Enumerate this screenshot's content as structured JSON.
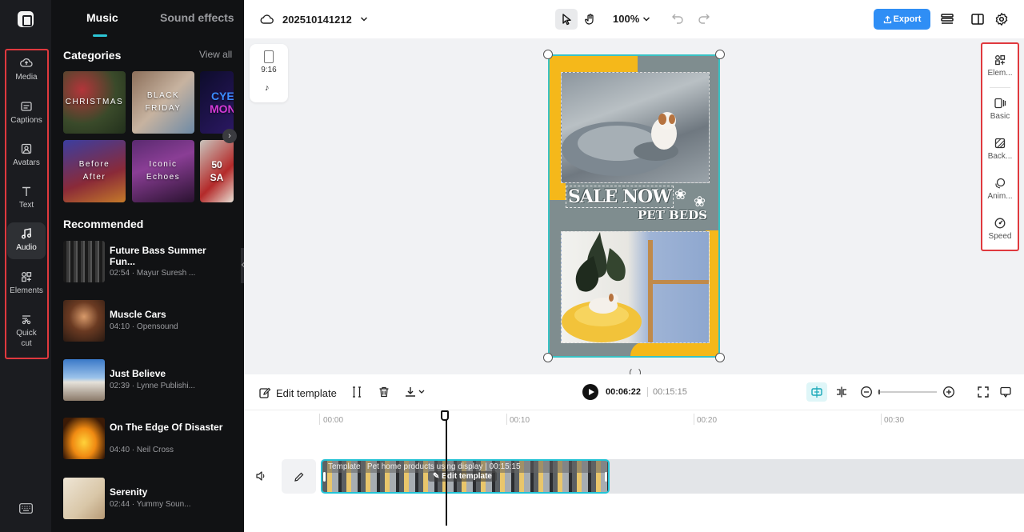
{
  "app": {
    "colors": {
      "accent": "#2cc6d6",
      "export_blue": "#2f8ef5",
      "highlight_red": "#e0393e",
      "rail_bg": "#1b1c20",
      "panel_bg": "#111214"
    }
  },
  "rail": {
    "items": [
      {
        "label": "Media",
        "icon": "cloud-upload-icon"
      },
      {
        "label": "Captions",
        "icon": "captions-icon"
      },
      {
        "label": "Avatars",
        "icon": "avatar-icon"
      },
      {
        "label": "Text",
        "icon": "text-icon"
      },
      {
        "label": "Audio",
        "icon": "music-note-icon",
        "active": true
      },
      {
        "label": "Elements",
        "icon": "elements-icon"
      },
      {
        "label": "Quick",
        "label2": "cut",
        "icon": "quick-cut-icon"
      }
    ]
  },
  "panel": {
    "tabs": [
      "Music",
      "Sound effects"
    ],
    "active_tab": "Music",
    "categories_title": "Categories",
    "view_all": "View all",
    "categories": [
      {
        "line1": "CHRISTMAS",
        "line2": ""
      },
      {
        "line1": "BLACK",
        "line2": "FRIDAY"
      },
      {
        "line1": "CYE",
        "line2": "MON"
      },
      {
        "line1": "Before",
        "line2": "After"
      },
      {
        "line1": "Iconic",
        "line2": "Echoes"
      },
      {
        "line1": "50",
        "line2": "SA"
      }
    ],
    "recommended_title": "Recommended",
    "tracks": [
      {
        "name": "Future Bass Summer Fun...",
        "meta": "02:54 · Mayur Suresh ..."
      },
      {
        "name": "Muscle Cars",
        "meta": "04:10 · Opensound"
      },
      {
        "name": "Just Believe",
        "meta": "02:39 · Lynne Publishi..."
      },
      {
        "name": "On The Edge Of Disaster",
        "meta": "04:40 · Neil Cross"
      },
      {
        "name": "Serenity",
        "meta": "02:44 · Yummy Soun..."
      }
    ]
  },
  "topbar": {
    "project_name": "202510141212",
    "zoom": "100%",
    "export_label": "Export"
  },
  "canvas": {
    "ratio_label": "9:16",
    "poster": {
      "headline": "SALE NOW",
      "subhead": "PET BEDS"
    }
  },
  "right_panel": {
    "items": [
      "Elem...",
      "Basic",
      "Back...",
      "Anim...",
      "Speed"
    ]
  },
  "timeline": {
    "edit_template": "Edit template",
    "current_time": "00:06:22",
    "total_time": "00:15:15",
    "ticks": [
      "00:00",
      "00:10",
      "00:20",
      "00:30"
    ],
    "clip": {
      "tag": "Template",
      "title": "Pet home products using display",
      "duration": "00:15:15",
      "edit_label": "Edit template"
    }
  }
}
